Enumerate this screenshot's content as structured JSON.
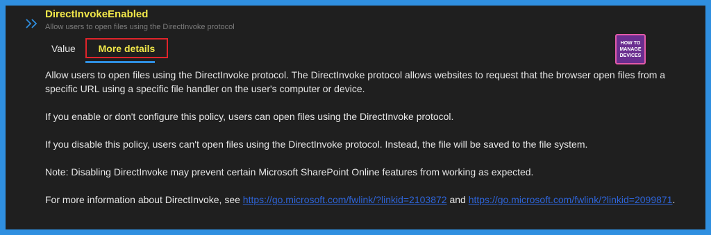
{
  "policy": {
    "name": "DirectInvokeEnabled",
    "summary": "Allow users to open files using the DirectInvoke protocol"
  },
  "tabs": [
    {
      "label": "Value"
    },
    {
      "label": "More details"
    }
  ],
  "logo": {
    "text": "HOW TO MANAGE DEVICES"
  },
  "details": {
    "p1": "Allow users to open files using the DirectInvoke protocol. The DirectInvoke protocol allows websites to request that the browser open files from a specific URL using a specific file handler on the user's computer or device.",
    "p2": "If you enable or don't configure this policy, users can open files using the DirectInvoke protocol.",
    "p3": "If you disable this policy, users can't open files using the DirectInvoke protocol. Instead, the file will be saved to the file system.",
    "p4": "Note: Disabling DirectInvoke may prevent certain Microsoft SharePoint Online features from working as expected.",
    "p5_prefix": "For more information about DirectInvoke, see ",
    "link1": "https://go.microsoft.com/fwlink/?linkid=2103872",
    "p5_and": " and ",
    "link2": "https://go.microsoft.com/fwlink/?linkid=2099871",
    "p5_suffix": "."
  },
  "colors": {
    "accent": "#2f8fe0",
    "title": "#f2e84a",
    "highlight_border": "#e0242b",
    "link": "#2e64d8"
  }
}
